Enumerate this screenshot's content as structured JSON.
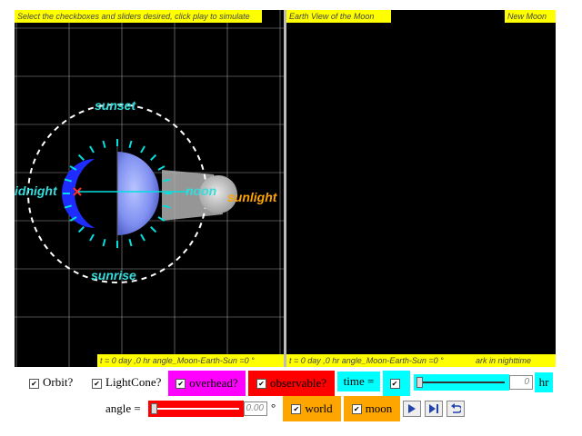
{
  "left_panel": {
    "instruction": "Select the checkboxes and sliders desired, click play to simulate",
    "status": "t = 0 day ,0 hr angle_Moon-Earth-Sun =0 °",
    "labels": {
      "sunset": "sunset",
      "sunrise": "sunrise",
      "midnight": "idnight",
      "noon": "noon",
      "sunlight": "sunlight"
    }
  },
  "right_panel": {
    "title": "Earth View of the Moon",
    "phase": "New Moon",
    "status": "t = 0 day ,0 hr angle_Moon-Earth-Sun =0 °",
    "note": "ark in nighttime"
  },
  "controls": {
    "orbit_label": "Orbit?",
    "lightcone_label": "LightCone?",
    "overhead_label": "overhead?",
    "observable_label": "observable?",
    "time_label": "time =",
    "time_value": "0",
    "time_unit": "hr",
    "angle_label": "angle =",
    "angle_value": "0.00",
    "angle_unit": "°",
    "world_label": "world",
    "moon_label": "moon",
    "check_mark": "✔"
  },
  "colors": {
    "yellow": "#ffff00",
    "magenta": "#ff00ff",
    "red": "#ff0000",
    "cyan": "#00ffff",
    "orange": "#ffa500",
    "label_cyan": "#33dddd",
    "sunlight": "#ffa500"
  }
}
